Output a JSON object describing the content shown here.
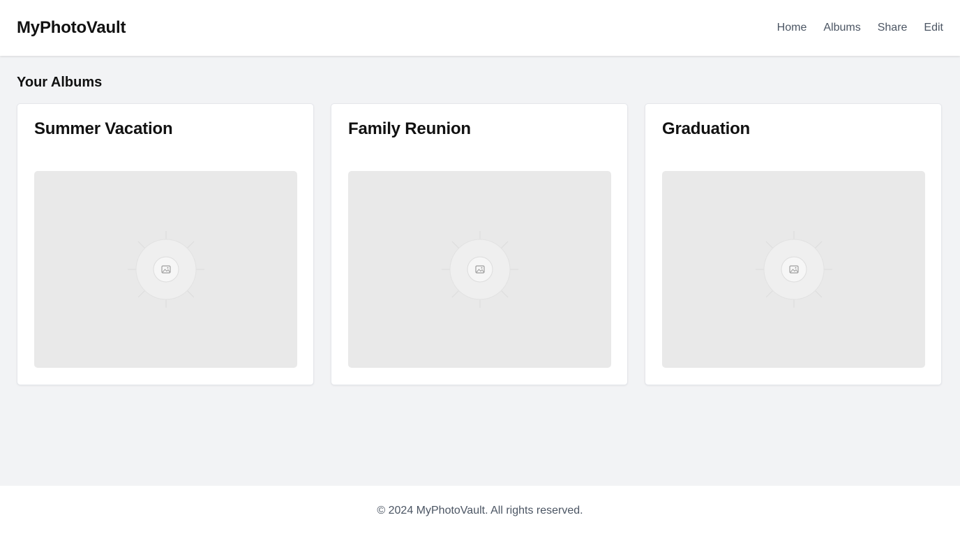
{
  "header": {
    "logo": "MyPhotoVault",
    "nav": [
      {
        "label": "Home"
      },
      {
        "label": "Albums"
      },
      {
        "label": "Share"
      },
      {
        "label": "Edit"
      }
    ]
  },
  "main": {
    "section_title": "Your Albums",
    "albums": [
      {
        "title": "Summer Vacation",
        "thumbnail_icon": "image-placeholder-icon"
      },
      {
        "title": "Family Reunion",
        "thumbnail_icon": "image-placeholder-icon"
      },
      {
        "title": "Graduation",
        "thumbnail_icon": "image-placeholder-icon"
      }
    ]
  },
  "footer": {
    "copyright": "© 2024 MyPhotoVault. All rights reserved."
  },
  "colors": {
    "page_background": "#f2f3f5",
    "surface": "#ffffff",
    "text_primary": "#111111",
    "text_secondary": "#4b5563",
    "thumbnail_background": "#e9e9e9"
  }
}
